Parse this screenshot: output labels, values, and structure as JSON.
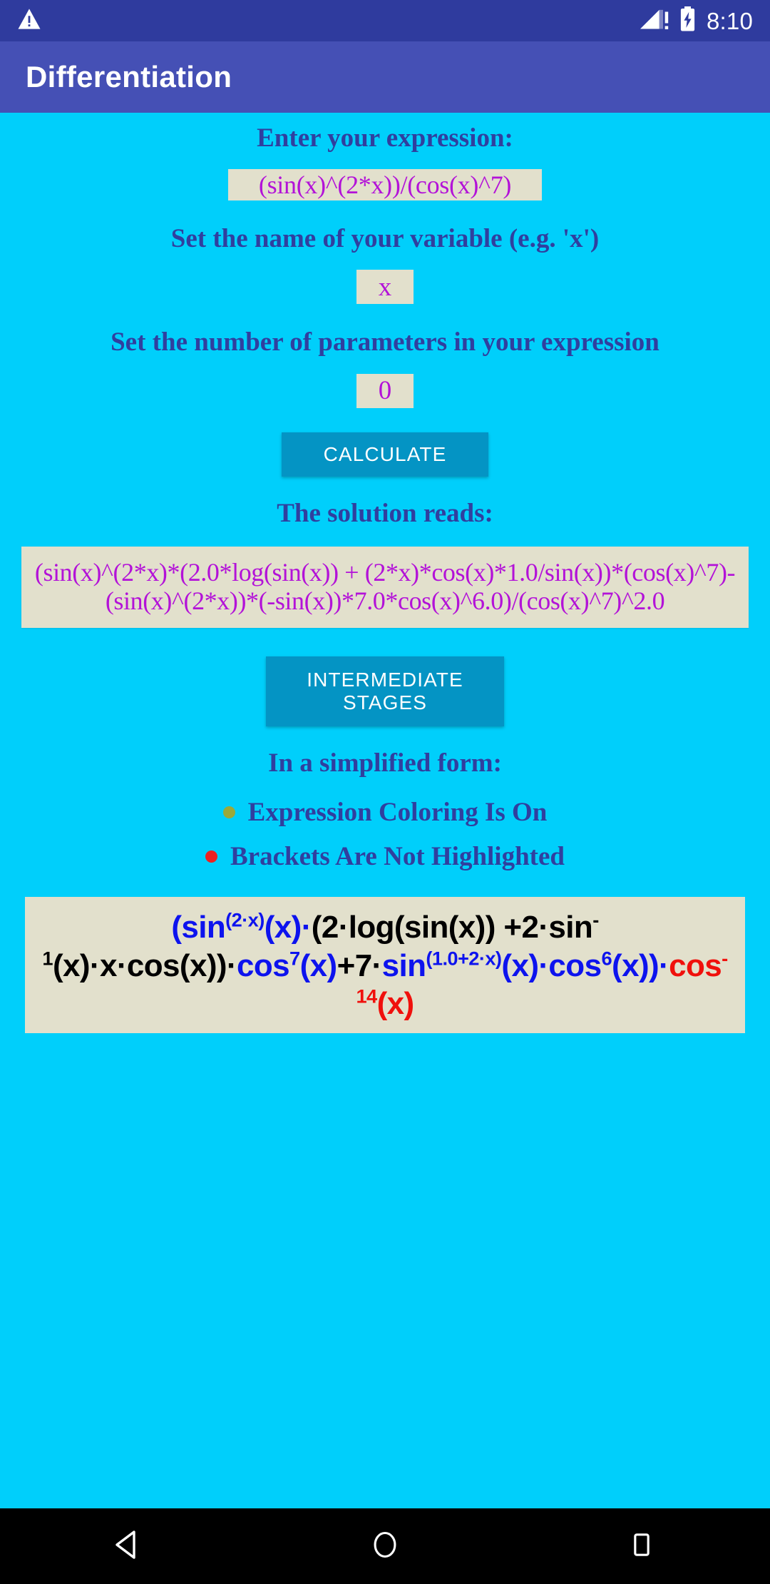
{
  "status_bar": {
    "warning_icon": "warning-triangle-icon",
    "signal_icon": "signal-no-service-icon",
    "battery_icon": "battery-charging-icon",
    "time": "8:10"
  },
  "app_bar": {
    "title": "Differentiation"
  },
  "form": {
    "expression_label": "Enter your expression:",
    "expression_value": "(sin(x)^(2*x))/(cos(x)^7)",
    "variable_label": "Set the name of your variable (e.g. 'x')",
    "variable_value": "x",
    "parameters_label": "Set the number of parameters in your expression",
    "parameters_value": "0",
    "calculate_label": "CALCULATE"
  },
  "solution": {
    "heading": "The solution reads:",
    "text": "(sin(x)^(2*x)*(2.0*log(sin(x)) + (2*x)*cos(x)*1.0/sin(x))*(cos(x)^7)-(sin(x)^(2*x))*(-sin(x))*7.0*cos(x)^6.0)/(cos(x)^7)^2.0",
    "intermediate_stages_label": "INTERMEDIATE STAGES"
  },
  "simplified": {
    "heading": "In a simplified form:",
    "options": [
      {
        "label": "Expression Coloring Is On",
        "bullet_color": "#9BA93A"
      },
      {
        "label": "Brackets Are Not Highlighted",
        "bullet_color": "#EE2020"
      }
    ],
    "pretty_expression_parts": [
      {
        "text": "(sin",
        "color": "#0D13EE",
        "sup": ""
      },
      {
        "text": "",
        "color": "#0D13EE",
        "sup": "(2·x)"
      },
      {
        "text": "(x)·",
        "color": "#0D13EE",
        "sup": ""
      },
      {
        "text": "(2·log(sin(x)) +2·sin",
        "color": "#000000",
        "sup": ""
      },
      {
        "text": "",
        "color": "#000000",
        "sup": "-1"
      },
      {
        "text": "(x)·x·cos(x))·",
        "color": "#000000",
        "sup": ""
      },
      {
        "text": "cos",
        "color": "#0D13EE",
        "sup": "7"
      },
      {
        "text": "(x)",
        "color": "#0D13EE",
        "sup": ""
      },
      {
        "text": "+7·",
        "color": "#000000",
        "sup": ""
      },
      {
        "text": "sin",
        "color": "#0D13EE",
        "sup": "(1.0+2·x)"
      },
      {
        "text": "(x)·cos",
        "color": "#0D13EE",
        "sup": "6"
      },
      {
        "text": "(x))·",
        "color": "#0D13EE",
        "sup": ""
      },
      {
        "text": "cos",
        "color": "#F0100C",
        "sup": "-14"
      },
      {
        "text": "(x)",
        "color": "#F0100C",
        "sup": ""
      }
    ],
    "pretty_expression_plain": "(sin^(2·x)(x)·(2·log(sin(x)) +2·sin^-1(x)·x·cos(x))·cos^7(x)+7·sin^(1.0+2·x)(x)·cos^6(x))·cos^-14(x)"
  },
  "nav_bar": {
    "back": "back-triangle-icon",
    "home": "home-circle-icon",
    "recents": "recents-square-icon"
  },
  "colors": {
    "background": "#00CFFB",
    "app_bar": "#4550B5",
    "status_bar": "#2F3B9E",
    "field_bg": "#E2E0CC",
    "field_text": "#B312D8",
    "label_text": "#303F9F",
    "button": "#0494C4"
  }
}
